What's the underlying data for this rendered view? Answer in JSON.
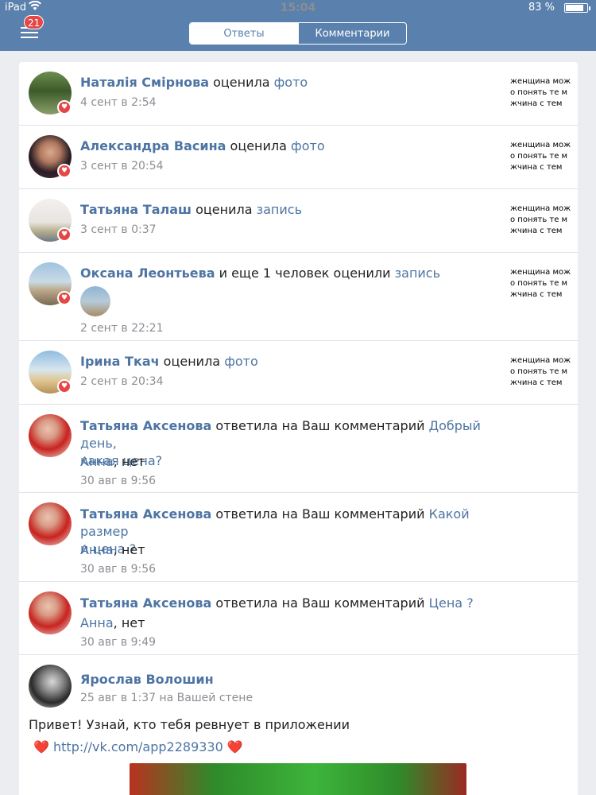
{
  "status": {
    "device": "iPad",
    "time": "15:04",
    "battery": "83 %"
  },
  "header": {
    "badge": "21",
    "tabs": [
      "Ответы",
      "Комментарии"
    ]
  },
  "items": [
    {
      "name": "Наталія Смірнова",
      "action": " оценила ",
      "target": "фото",
      "time": "4 сент в 2:54",
      "thumb": [
        "женщина мож",
        "о понять те м",
        "жчина с тем"
      ]
    },
    {
      "name": "Александра Васина",
      "action": " оценила ",
      "target": "фото",
      "time": "3 сент в 20:54",
      "thumb": [
        "женщина мож",
        "о понять те м",
        "жчина с тем"
      ]
    },
    {
      "name": "Татьяна Талаш",
      "action": " оценила ",
      "target": "запись",
      "time": "3 сент в 0:37",
      "thumb": [
        "женщина мож",
        "о понять те м",
        "жчина с тем"
      ]
    },
    {
      "name": "Оксана Леонтьева",
      "action": " и еще 1 человек оценили ",
      "target": "запись",
      "time": "2 сент в 22:21",
      "thumb": [
        "женщина мож",
        "о понять те м",
        "жчина с тем"
      ]
    },
    {
      "name": "Ірина Ткач",
      "action": " оценила ",
      "target": "фото",
      "time": "2 сент в 20:34",
      "thumb": [
        "женщина мож",
        "о понять те м",
        "жчина с тем"
      ]
    }
  ],
  "replies": [
    {
      "name": "Татьяна Аксенова",
      "action": " ответила на Ваш комментарий ",
      "target1": "Добрый день,",
      "target2": "какая цена?",
      "reply_to": "Анна",
      "reply_text": ", нет",
      "time": "30 авг в 9:56"
    },
    {
      "name": "Татьяна Аксенова",
      "action": " ответила на Ваш комментарий ",
      "target1": "Какой размер",
      "target2": "и цена ?",
      "reply_to": "Анна",
      "reply_text": ", нет",
      "time": "30 авг в 9:56"
    },
    {
      "name": "Татьяна Аксенова",
      "action": " ответила на Ваш комментарий ",
      "target1": "Цена ?",
      "reply_to": "Анна",
      "reply_text": ", нет",
      "time": "30 авг в 9:49"
    }
  ],
  "post": {
    "name": "Ярослав Волошин",
    "time": "25 авг в 1:37 на Вашей стене",
    "text": "Привет! Узнай, кто тебя ревнует в приложении",
    "link": "http://vk.com/app2289330",
    "heart": "❤️"
  },
  "colors": {
    "header": "#5a80ad",
    "accent": "#4d74a3",
    "heart": "#e64646"
  }
}
